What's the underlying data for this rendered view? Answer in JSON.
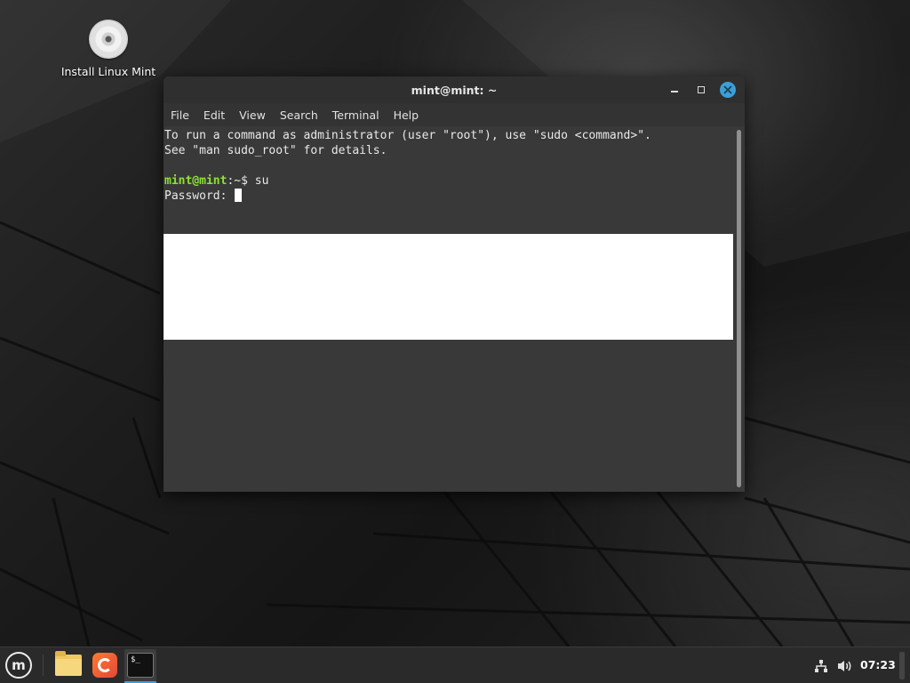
{
  "desktop": {
    "icon_label": "Install Linux Mint"
  },
  "window": {
    "title": "mint@mint: ~",
    "menu": [
      "File",
      "Edit",
      "View",
      "Search",
      "Terminal",
      "Help"
    ]
  },
  "terminal": {
    "line1": "To run a command as administrator (user \"root\"), use \"sudo <command>\".",
    "line2": "See \"man sudo_root\" for details.",
    "prompt_user": "mint@mint",
    "prompt_path": ":~$ ",
    "command": "su",
    "password_prompt": "Password: "
  },
  "taskbar": {
    "clock": "07:23",
    "menu_icon": "mint-logo-icon",
    "apps": [
      "file-manager-icon",
      "firefox-icon",
      "terminal-icon"
    ],
    "terminal_icon_text": "$_"
  },
  "colors": {
    "accent": "#3c9fd8",
    "prompt_green": "#8ae234",
    "terminal_bg": "#393939"
  }
}
